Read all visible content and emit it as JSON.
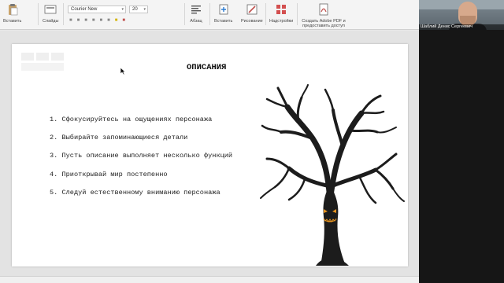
{
  "ribbon": {
    "paste_label": "Вставить",
    "slides_label": "Слайды",
    "font_name": "Courier New",
    "font_size": "20",
    "paragraph_label": "Абзац",
    "insert_label": "Вставить",
    "drawing_label": "Рисование",
    "addins_label": "Надстройки",
    "adobe_label": "Создать Adobe PDF и предоставить доступ"
  },
  "slide": {
    "title": "ОПИСАНИЯ",
    "bullets": [
      "1. Сфокусируйтесь на ощущениях персонажа",
      "2. Выбирайте запоминающиеся детали",
      "3. Пусть описание выполняет несколько функций",
      "4. Приоткрывай мир постепенно",
      "5. Следуй естественному вниманию персонажа"
    ]
  },
  "video": {
    "participant_name": "Шаблий Денис Сергеевич"
  },
  "colors": {
    "accent_red": "#c0504d",
    "pumpkin_orange": "#e7931e"
  },
  "icons": [
    "paste-icon",
    "slides-icon",
    "paragraph-icon",
    "insert-icon",
    "drawing-icon",
    "addins-icon",
    "adobe-pdf-icon",
    "mouse-cursor-icon"
  ]
}
